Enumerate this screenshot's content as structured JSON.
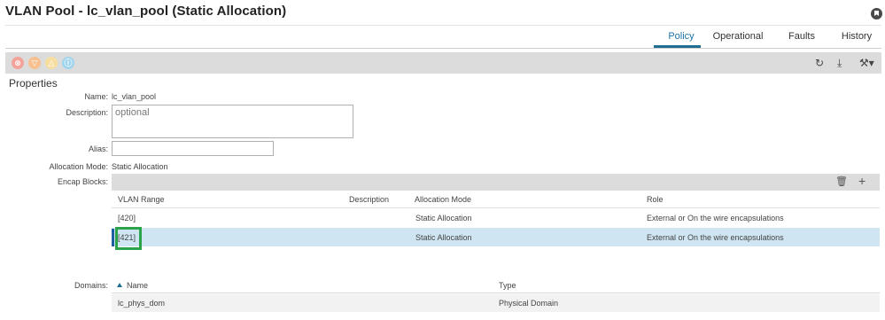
{
  "header": {
    "title": "VLAN Pool - lc_vlan_pool (Static Allocation)"
  },
  "tabs": [
    {
      "label": "Policy",
      "active": true
    },
    {
      "label": "Operational",
      "active": false
    },
    {
      "label": "Faults",
      "active": false
    },
    {
      "label": "History",
      "active": false
    }
  ],
  "toolbar": {
    "fault_icons": [
      "critical-fault",
      "major-fault",
      "minor-fault",
      "warning-fault"
    ],
    "fault_glyphs": [
      "⊗",
      "▽",
      "△",
      "ⓘ"
    ],
    "refresh_glyph": "↻",
    "download_glyph": "⤓",
    "tools_glyph": "⚒▾"
  },
  "properties": {
    "section_title": "Properties",
    "name_label": "Name:",
    "name_value": "lc_vlan_pool",
    "description_label": "Description:",
    "description_placeholder": "optional",
    "alias_label": "Alias:",
    "alias_value": "",
    "allocation_mode_label": "Allocation Mode:",
    "allocation_mode_value": "Static Allocation",
    "encap_blocks_label": "Encap Blocks:",
    "domains_label": "Domains:"
  },
  "encap_blocks": {
    "delete_glyph": "🗑",
    "add_glyph": "+",
    "columns": [
      "VLAN Range",
      "Description",
      "Allocation Mode",
      "Role"
    ],
    "rows": [
      {
        "vlan_range": "[420]",
        "description": "",
        "allocation_mode": "Static Allocation",
        "role": "External or On the wire encapsulations",
        "selected": false
      },
      {
        "vlan_range": "[421]",
        "description": "",
        "allocation_mode": "Static Allocation",
        "role": "External or On the wire encapsulations",
        "selected": true
      }
    ]
  },
  "domains": {
    "columns": [
      "Name",
      "Type"
    ],
    "rows": [
      {
        "name": "lc_phys_dom",
        "type": "Physical Domain"
      }
    ]
  },
  "colors": {
    "accent": "#1f6d92",
    "selected_row": "#cfe6f2",
    "highlight_box": "#2aa34a"
  }
}
